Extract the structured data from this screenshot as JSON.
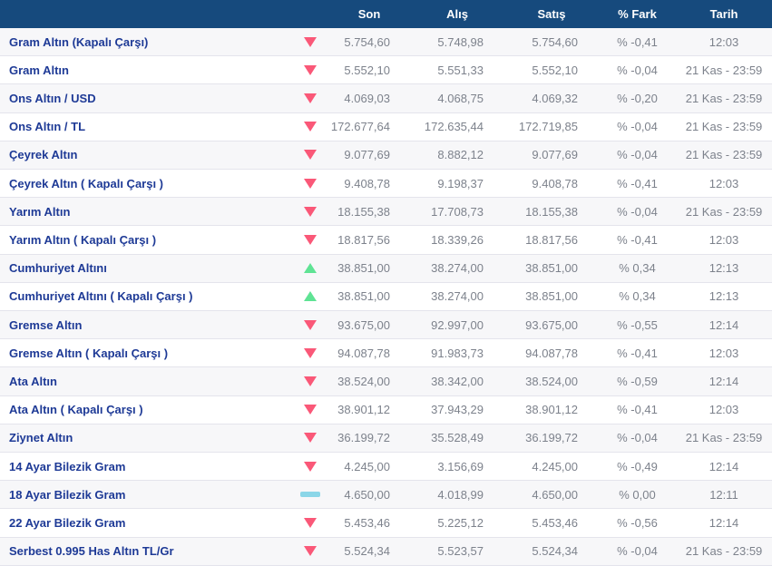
{
  "table": {
    "columns": {
      "name": "",
      "son": "Son",
      "alis": "Alış",
      "satis": "Satış",
      "fark": "% Fark",
      "tarih": "Tarih"
    },
    "rows": [
      {
        "name": "Gram Altın (Kapalı Çarşı)",
        "trend": "down",
        "son": "5.754,60",
        "alis": "5.748,98",
        "satis": "5.754,60",
        "fark": "% -0,41",
        "tarih": "12:03"
      },
      {
        "name": "Gram Altın",
        "trend": "down",
        "son": "5.552,10",
        "alis": "5.551,33",
        "satis": "5.552,10",
        "fark": "% -0,04",
        "tarih": "21 Kas - 23:59"
      },
      {
        "name": "Ons Altın / USD",
        "trend": "down",
        "son": "4.069,03",
        "alis": "4.068,75",
        "satis": "4.069,32",
        "fark": "% -0,20",
        "tarih": "21 Kas - 23:59"
      },
      {
        "name": "Ons Altın / TL",
        "trend": "down",
        "son": "172.677,64",
        "alis": "172.635,44",
        "satis": "172.719,85",
        "fark": "% -0,04",
        "tarih": "21 Kas - 23:59"
      },
      {
        "name": "Çeyrek Altın",
        "trend": "down",
        "son": "9.077,69",
        "alis": "8.882,12",
        "satis": "9.077,69",
        "fark": "% -0,04",
        "tarih": "21 Kas - 23:59"
      },
      {
        "name": "Çeyrek Altın ( Kapalı Çarşı )",
        "trend": "down",
        "son": "9.408,78",
        "alis": "9.198,37",
        "satis": "9.408,78",
        "fark": "% -0,41",
        "tarih": "12:03"
      },
      {
        "name": "Yarım Altın",
        "trend": "down",
        "son": "18.155,38",
        "alis": "17.708,73",
        "satis": "18.155,38",
        "fark": "% -0,04",
        "tarih": "21 Kas - 23:59"
      },
      {
        "name": "Yarım Altın ( Kapalı Çarşı )",
        "trend": "down",
        "son": "18.817,56",
        "alis": "18.339,26",
        "satis": "18.817,56",
        "fark": "% -0,41",
        "tarih": "12:03"
      },
      {
        "name": "Cumhuriyet Altını",
        "trend": "up",
        "son": "38.851,00",
        "alis": "38.274,00",
        "satis": "38.851,00",
        "fark": "% 0,34",
        "tarih": "12:13"
      },
      {
        "name": "Cumhuriyet Altını ( Kapalı Çarşı )",
        "trend": "up",
        "son": "38.851,00",
        "alis": "38.274,00",
        "satis": "38.851,00",
        "fark": "% 0,34",
        "tarih": "12:13"
      },
      {
        "name": "Gremse Altın",
        "trend": "down",
        "son": "93.675,00",
        "alis": "92.997,00",
        "satis": "93.675,00",
        "fark": "% -0,55",
        "tarih": "12:14"
      },
      {
        "name": "Gremse Altın ( Kapalı Çarşı )",
        "trend": "down",
        "son": "94.087,78",
        "alis": "91.983,73",
        "satis": "94.087,78",
        "fark": "% -0,41",
        "tarih": "12:03"
      },
      {
        "name": "Ata Altın",
        "trend": "down",
        "son": "38.524,00",
        "alis": "38.342,00",
        "satis": "38.524,00",
        "fark": "% -0,59",
        "tarih": "12:14"
      },
      {
        "name": "Ata Altın ( Kapalı Çarşı )",
        "trend": "down",
        "son": "38.901,12",
        "alis": "37.943,29",
        "satis": "38.901,12",
        "fark": "% -0,41",
        "tarih": "12:03"
      },
      {
        "name": "Ziynet Altın",
        "trend": "down",
        "son": "36.199,72",
        "alis": "35.528,49",
        "satis": "36.199,72",
        "fark": "% -0,04",
        "tarih": "21 Kas - 23:59"
      },
      {
        "name": "14 Ayar Bilezik Gram",
        "trend": "down",
        "son": "4.245,00",
        "alis": "3.156,69",
        "satis": "4.245,00",
        "fark": "% -0,49",
        "tarih": "12:14"
      },
      {
        "name": "18 Ayar Bilezik Gram",
        "trend": "flat",
        "son": "4.650,00",
        "alis": "4.018,99",
        "satis": "4.650,00",
        "fark": "% 0,00",
        "tarih": "12:11"
      },
      {
        "name": "22 Ayar Bilezik Gram",
        "trend": "down",
        "son": "5.453,46",
        "alis": "5.225,12",
        "satis": "5.453,46",
        "fark": "% -0,56",
        "tarih": "12:14"
      },
      {
        "name": "Serbest 0.995 Has Altın TL/Gr",
        "trend": "down",
        "son": "5.524,34",
        "alis": "5.523,57",
        "satis": "5.524,34",
        "fark": "% -0,04",
        "tarih": "21 Kas - 23:59"
      }
    ]
  },
  "colors": {
    "header_background": "#164a7d",
    "header_text": "#ffffff",
    "instrument_link_blue": "#1e3a96",
    "value_gray": "#7d828c",
    "trend_down_red": "#fa5878",
    "trend_up_green": "#5fe394",
    "trend_flat_cyan": "#8bd6e8",
    "alt_row_background": "#f7f7f9",
    "row_border": "#e4e4ec"
  }
}
